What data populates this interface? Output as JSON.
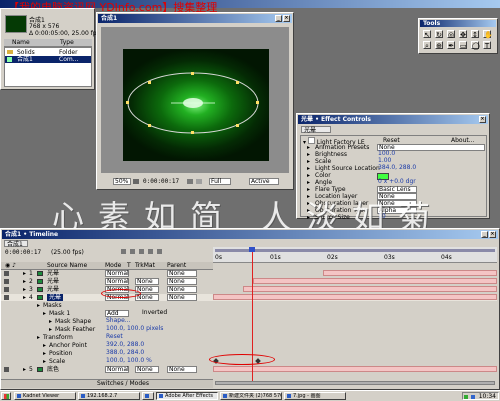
{
  "watermark_top": "【我的电脑资讯网 YDInfo.com】搜集整理",
  "watermark_mid": "心素如简 人淡如菊",
  "project": {
    "title": "Adobe After Effects",
    "comp_name": "合成1",
    "info_line1": "768 x 576",
    "info_line2": "Δ 0:00:05:00, 25.00 fps",
    "columns": [
      "Name",
      "Type"
    ],
    "items": [
      {
        "name": "Solids",
        "type": "Folder"
      },
      {
        "name": "合成1",
        "type": "Com..."
      }
    ]
  },
  "comp_window": {
    "title": "合成1",
    "zoom": "50%",
    "timecode": "0:00:00:17",
    "resolution": "Full",
    "camera": "Active C..."
  },
  "tools": {
    "title": "Tools",
    "icons": [
      "arrow-icon",
      "rotate-icon",
      "orbit-camera-icon",
      "track-xy-icon",
      "track-z-icon",
      "hand-icon",
      "zoom-icon",
      "pan-behind-icon",
      "pen-icon",
      "rectangle-icon",
      "ellipse-icon",
      "text-icon"
    ]
  },
  "effect_controls": {
    "title": "Effect Controls",
    "layer": "光晕",
    "effect": "Light Factory LE",
    "reset": "Reset",
    "about": "About...",
    "props": [
      {
        "name": "Animation Presets",
        "value": "None"
      },
      {
        "name": "Brightness",
        "value": "100.0"
      },
      {
        "name": "Scale",
        "value": "1.00"
      },
      {
        "name": "Light Source Location",
        "value": "384.0, 288.0"
      },
      {
        "name": "Color",
        "value": ""
      },
      {
        "name": "Angle",
        "value": "0 x +0.0 dgr"
      },
      {
        "name": "Flare Type",
        "value": "Basic Lens"
      },
      {
        "name": "Location layer",
        "value": "None"
      },
      {
        "name": "Obscuration layer",
        "value": "None"
      },
      {
        "name": "Obscuration Type",
        "value": "Alpha"
      },
      {
        "name": "Source Size",
        "value": "10"
      }
    ]
  },
  "timeline": {
    "title": "合成1 • Timeline",
    "tab": "合成1",
    "timecode": "0:00:00:17",
    "fps": "(25.00 fps)",
    "col_source": "Source Name",
    "col_mode": "Mode",
    "col_t": "T",
    "col_trkmat": "TrkMat",
    "col_parent": "Parent",
    "ruler": [
      "0s",
      "01s",
      "02s",
      "03s",
      "04s"
    ],
    "switches": "Switches / Modes",
    "rows": [
      {
        "num": "1",
        "name": "光晕",
        "mode": "Normal",
        "trk": "",
        "parent": "None",
        "indent": 0,
        "sel": false
      },
      {
        "num": "2",
        "name": "光晕",
        "mode": "Normal",
        "trk": "None",
        "parent": "None",
        "indent": 0,
        "sel": false
      },
      {
        "num": "3",
        "name": "光晕",
        "mode": "Normal",
        "trk": "None",
        "parent": "None",
        "indent": 0,
        "sel": false
      },
      {
        "num": "4",
        "name": "光晕",
        "mode": "Normal",
        "trk": "None",
        "parent": "None",
        "indent": 0,
        "sel": true
      },
      {
        "num": "",
        "name": "Masks",
        "mode": "",
        "trk": "",
        "parent": "",
        "indent": 1,
        "sel": false
      },
      {
        "num": "",
        "name": "Mask 1",
        "mode": "Add",
        "trk": "Inverted",
        "parent": "",
        "indent": 2,
        "sel": false
      },
      {
        "num": "",
        "name": "Mask Shape",
        "mode": "Shape...",
        "trk": "",
        "parent": "",
        "indent": 3,
        "sel": false
      },
      {
        "num": "",
        "name": "Mask Feather",
        "mode": "100.0, 100.0 pixels",
        "trk": "",
        "parent": "",
        "indent": 3,
        "sel": false
      },
      {
        "num": "",
        "name": "Transform",
        "mode": "Reset",
        "trk": "",
        "parent": "",
        "indent": 1,
        "sel": false
      },
      {
        "num": "",
        "name": "Anchor Point",
        "mode": "392.0, 288.0",
        "trk": "",
        "parent": "",
        "indent": 2,
        "sel": false
      },
      {
        "num": "",
        "name": "Position",
        "mode": "388.0, 284.0",
        "trk": "",
        "parent": "",
        "indent": 2,
        "sel": false
      },
      {
        "num": "",
        "name": "Scale",
        "mode": "100.0, 100.0 %",
        "trk": "",
        "parent": "",
        "indent": 2,
        "sel": false
      },
      {
        "num": "5",
        "name": "底色",
        "mode": "Normal",
        "trk": "None",
        "parent": "None",
        "indent": 0,
        "sel": false
      }
    ]
  },
  "taskbar": {
    "items": [
      "Kadnet Viewer",
      "192.168.2.7",
      "",
      "Adobe After Effects",
      "新建文件夹 (2)768 576...",
      "7.jpg - 画图"
    ],
    "clock": "10:34"
  }
}
